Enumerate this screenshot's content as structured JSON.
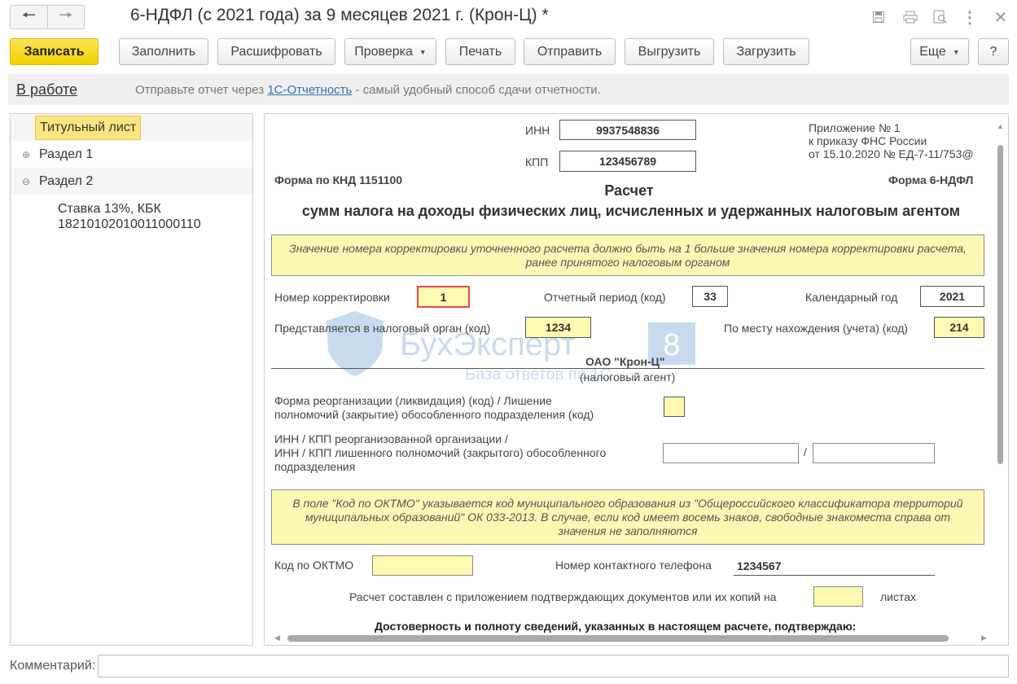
{
  "window": {
    "title": "6-НДФЛ (с 2021 года) за 9 месяцев 2021 г. (Крон-Ц) *",
    "icons": [
      "save-icon",
      "print-icon",
      "preview-icon",
      "more-vert-icon",
      "close-icon"
    ]
  },
  "toolbar": {
    "write": "Записать",
    "fill": "Заполнить",
    "decode": "Расшифровать",
    "check": "Проверка",
    "print": "Печать",
    "send": "Отправить",
    "export": "Выгрузить",
    "import": "Загрузить",
    "more": "Еще",
    "help": "?"
  },
  "status_bar": {
    "status": "В работе",
    "text_before": "Отправьте отчет через ",
    "link": "1С-Отчетность",
    "text_after": " - самый удобный способ сдачи отчетности."
  },
  "tree": {
    "title_page": "Титульный лист",
    "section1": "Раздел 1",
    "section2": "Раздел 2",
    "child_line1": "Ставка 13%, КБК",
    "child_line2": "18210102010011000110"
  },
  "form": {
    "inn_label": "ИНН",
    "inn": "9937548836",
    "kpp_label": "КПП",
    "kpp": "123456789",
    "appendix_line1": "Приложение № 1",
    "appendix_line2": "к приказу ФНС России",
    "appendix_line3": "от 15.10.2020 № ЕД-7-11/753@",
    "knd": "Форма по КНД 1151100",
    "form_name": "Форма 6-НДФЛ",
    "title": "Расчет",
    "subtitle": "сумм налога на доходы физических лиц, исчисленных и удержанных налоговым агентом",
    "note1": "Значение номера корректировки уточненного расчета должно быть на 1 больше значения номера корректировки расчета, ранее принятого налоговым органом",
    "correction_label": "Номер корректировки",
    "correction": "1",
    "period_label": "Отчетный период (код)",
    "period": "33",
    "year_label": "Календарный год",
    "year": "2021",
    "tax_authority_label": "Представляется в налоговый орган (код)",
    "tax_authority": "1234",
    "location_label": "По месту нахождения (учета) (код)",
    "location": "214",
    "agent_name": "ОАО \"Крон-Ц\"",
    "agent_caption": "(налоговый агент)",
    "reorg_label_1": "Форма реорганизации (ликвидация) (код) / Лишение",
    "reorg_label_2": "полномочий (закрытие) обособленного подразделения (код)",
    "reorg_code": "",
    "inn_kpp_label_1": "ИНН / КПП реорганизованной организации /",
    "inn_kpp_label_2": "ИНН / КПП лишенного полномочий (закрытого) обособленного",
    "inn_kpp_label_3": "подразделения",
    "slash": "/",
    "note2": "В поле \"Код по ОКТМО\" указывается код муниципального образования из \"Общероссийского классификатора территорий муниципальных образований\" ОК 033-2013. В случае, если код имеет восемь знаков, свободные знакоместа справа от значения не заполняются",
    "oktmo_label": "Код по ОКТМО",
    "oktmo": "",
    "phone_label": "Номер контактного телефона",
    "phone": "1234567",
    "sheets_label": "Расчет составлен с приложением подтверждающих документов или их копий на",
    "sheets": "",
    "sheets_suffix": "листах",
    "confirm": "Достоверность и полноту сведений, указанных в настоящем расчете, подтверждаю:"
  },
  "watermark": {
    "brand": "БухЭксперт",
    "digit": "8",
    "tagline": "База ответов по 1С"
  },
  "comment": {
    "label": "Комментарий:",
    "value": ""
  },
  "colors": {
    "primary_button": "#f2cf00",
    "field_yellow": "#fdf9b0",
    "note_yellow": "#fdf7b4",
    "link_blue": "#3a6fb7",
    "error_red": "#e34a4a"
  }
}
